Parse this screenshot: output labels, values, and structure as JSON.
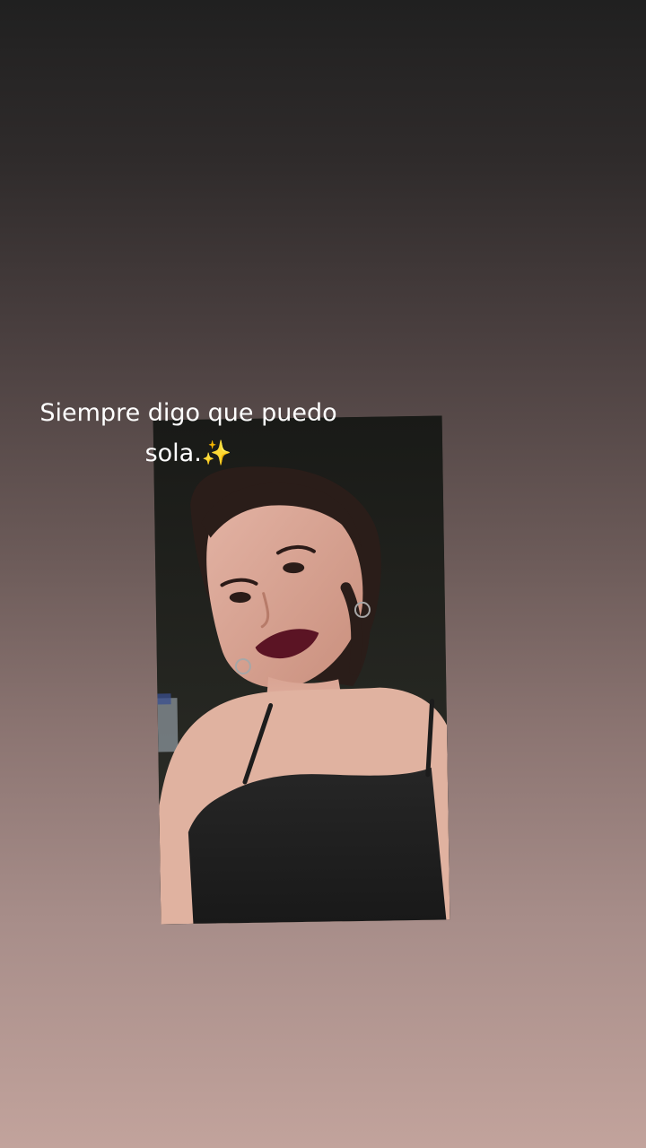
{
  "story": {
    "caption_line1": "Siempre digo que puedo",
    "caption_line2": "sola.✨"
  },
  "colors": {
    "background_top": "#202020",
    "background_bottom": "#c2a39c",
    "caption_text": "#ffffff",
    "lip_color": "#5b1424",
    "top_color": "#1f1f1f"
  }
}
